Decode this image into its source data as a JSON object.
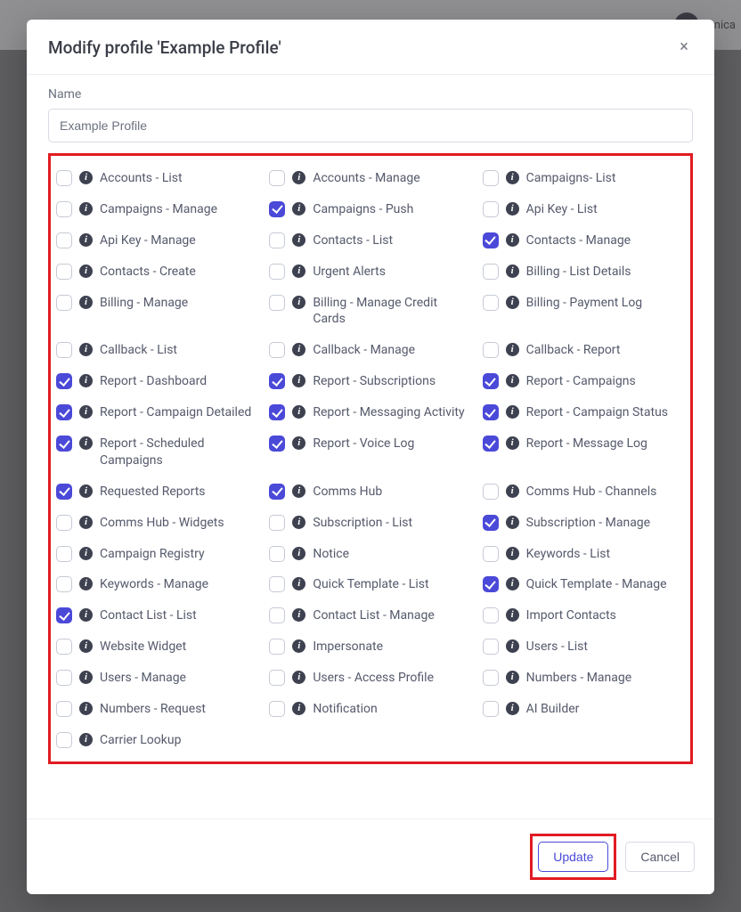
{
  "topbar": {
    "text_right": "hnica"
  },
  "modal": {
    "title": "Modify profile 'Example Profile'",
    "name_label": "Name",
    "name_value": "Example Profile",
    "update_label": "Update",
    "cancel_label": "Cancel"
  },
  "permissions": [
    {
      "label": "Accounts - List",
      "checked": false
    },
    {
      "label": "Accounts - Manage",
      "checked": false
    },
    {
      "label": "Campaigns- List",
      "checked": false
    },
    {
      "label": "Campaigns - Manage",
      "checked": false
    },
    {
      "label": "Campaigns - Push",
      "checked": true
    },
    {
      "label": "Api Key - List",
      "checked": false
    },
    {
      "label": "Api Key - Manage",
      "checked": false
    },
    {
      "label": "Contacts - List",
      "checked": false
    },
    {
      "label": "Contacts - Manage",
      "checked": true
    },
    {
      "label": "Contacts - Create",
      "checked": false
    },
    {
      "label": "Urgent Alerts",
      "checked": false
    },
    {
      "label": "Billing - List Details",
      "checked": false
    },
    {
      "label": "Billing - Manage",
      "checked": false
    },
    {
      "label": "Billing - Manage Credit Cards",
      "checked": false
    },
    {
      "label": "Billing - Payment Log",
      "checked": false
    },
    {
      "label": "Callback - List",
      "checked": false
    },
    {
      "label": "Callback - Manage",
      "checked": false
    },
    {
      "label": "Callback - Report",
      "checked": false
    },
    {
      "label": "Report - Dashboard",
      "checked": true
    },
    {
      "label": "Report - Subscriptions",
      "checked": true
    },
    {
      "label": "Report - Campaigns",
      "checked": true
    },
    {
      "label": "Report - Campaign Detailed",
      "checked": true
    },
    {
      "label": "Report - Messaging Activity",
      "checked": true
    },
    {
      "label": "Report - Campaign Status",
      "checked": true
    },
    {
      "label": "Report - Scheduled Campaigns",
      "checked": true
    },
    {
      "label": "Report - Voice Log",
      "checked": true
    },
    {
      "label": "Report - Message Log",
      "checked": true
    },
    {
      "label": "Requested Reports",
      "checked": true
    },
    {
      "label": "Comms Hub",
      "checked": true
    },
    {
      "label": "Comms Hub - Channels",
      "checked": false
    },
    {
      "label": "Comms Hub - Widgets",
      "checked": false
    },
    {
      "label": "Subscription - List",
      "checked": false
    },
    {
      "label": "Subscription - Manage",
      "checked": true
    },
    {
      "label": "Campaign Registry",
      "checked": false
    },
    {
      "label": "Notice",
      "checked": false
    },
    {
      "label": "Keywords - List",
      "checked": false
    },
    {
      "label": "Keywords - Manage",
      "checked": false
    },
    {
      "label": "Quick Template - List",
      "checked": false
    },
    {
      "label": "Quick Template - Manage",
      "checked": true
    },
    {
      "label": "Contact List - List",
      "checked": true
    },
    {
      "label": "Contact List - Manage",
      "checked": false
    },
    {
      "label": "Import Contacts",
      "checked": false
    },
    {
      "label": "Website Widget",
      "checked": false
    },
    {
      "label": "Impersonate",
      "checked": false
    },
    {
      "label": "Users - List",
      "checked": false
    },
    {
      "label": "Users - Manage",
      "checked": false
    },
    {
      "label": "Users - Access Profile",
      "checked": false
    },
    {
      "label": "Numbers - Manage",
      "checked": false
    },
    {
      "label": "Numbers - Request",
      "checked": false
    },
    {
      "label": "Notification",
      "checked": false
    },
    {
      "label": "AI Builder",
      "checked": false
    },
    {
      "label": "Carrier Lookup",
      "checked": false
    }
  ]
}
